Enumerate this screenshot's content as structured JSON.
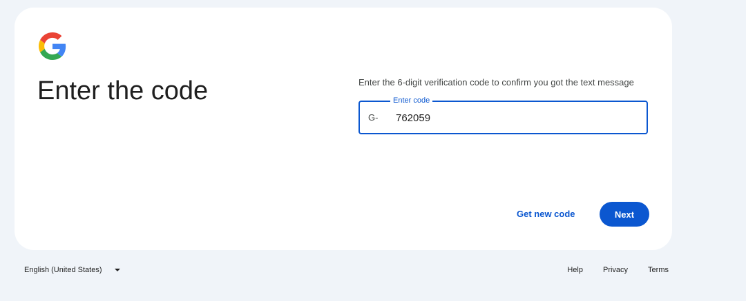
{
  "brand": {
    "logo_icon": "google-g-logo-icon",
    "colors": {
      "blue": "#4285F4",
      "red": "#EA4335",
      "yellow": "#FBBC05",
      "green": "#34A853",
      "accent": "#0b57d0",
      "background": "#f0f4f9"
    }
  },
  "page": {
    "title": "Enter the code",
    "instructions": "Enter the 6-digit verification code to confirm you got the text message"
  },
  "code_field": {
    "label": "Enter code",
    "prefix": "G-",
    "value": "762059"
  },
  "actions": {
    "get_new_code_label": "Get new code",
    "next_label": "Next"
  },
  "footer": {
    "language": "English (United States)",
    "language_icon": "caret-down-icon",
    "links": {
      "help": "Help",
      "privacy": "Privacy",
      "terms": "Terms"
    }
  }
}
